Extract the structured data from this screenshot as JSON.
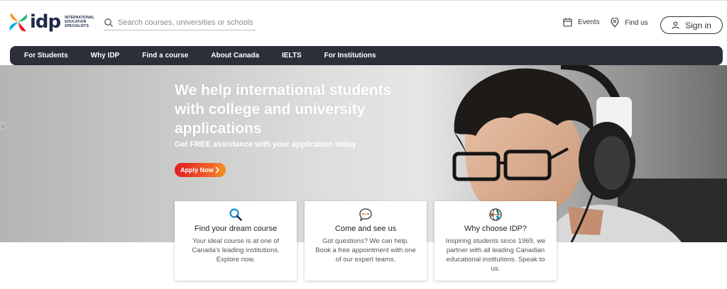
{
  "header": {
    "logo": {
      "wordmark": "idp",
      "tagline": [
        "INTERNATIONAL",
        "EDUCATION",
        "SPECIALISTS"
      ]
    },
    "search": {
      "placeholder": "Search courses, universities or schools"
    },
    "events_label": "Events",
    "findus_label": "Find us",
    "signin_label": "Sign in"
  },
  "nav": {
    "items": [
      "For Students",
      "Why IDP",
      "Find a course",
      "About Canada",
      "IELTS",
      "For Institutions"
    ]
  },
  "hero": {
    "title": "We help international students with college and university applications",
    "subtitle": "Get FREE assistance with your application today",
    "cta_label": "Apply Now"
  },
  "cards": [
    {
      "icon": "magnifier-icon",
      "title": "Find your dream course",
      "text": "Your ideal course is at one of Canada's leading institutions. Explore now."
    },
    {
      "icon": "chat-bubble-icon",
      "title": "Come and see us",
      "text": "Got questions? We can help. Book a free appointment with one of our expert teams."
    },
    {
      "icon": "globe-icon",
      "title": "Why choose IDP?",
      "text": "Inspiring students since 1969, we partner with all leading Canadian educational institutions. Speak to us."
    }
  ],
  "colors": {
    "nav_bg": "#2c2f3a",
    "cta_start": "#e31b23",
    "cta_end": "#f7931e",
    "brand_navy": "#1f2a4a"
  }
}
